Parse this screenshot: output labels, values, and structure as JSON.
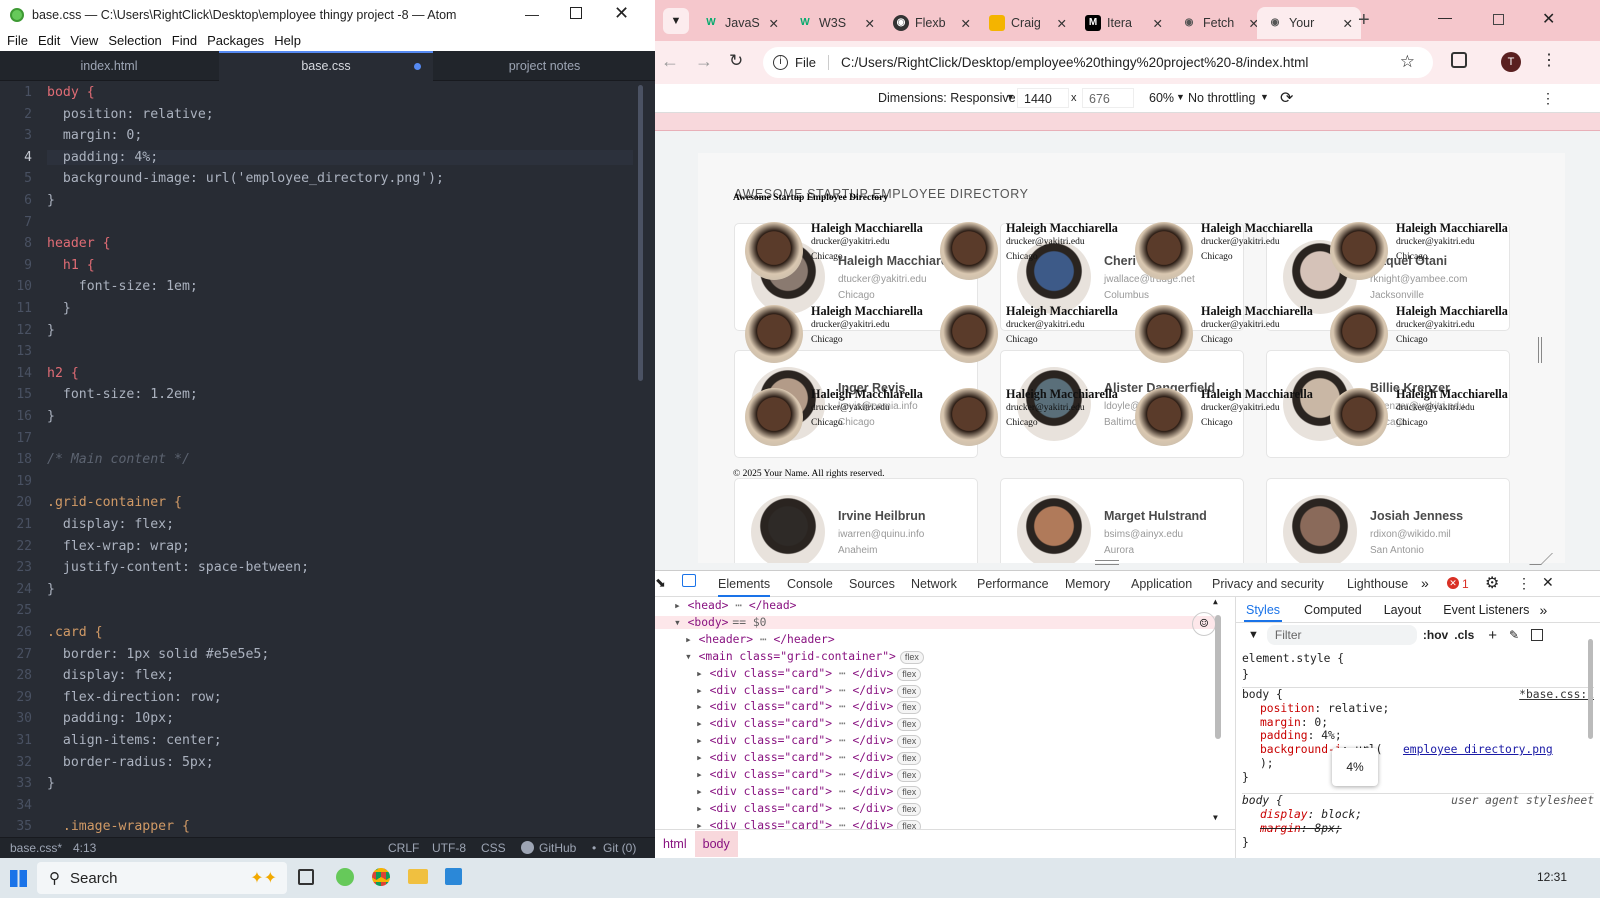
{
  "atom": {
    "title": "base.css — C:\\Users\\RightClick\\Desktop\\employee thingy project -8 — Atom",
    "menu": [
      "File",
      "Edit",
      "View",
      "Selection",
      "Find",
      "Packages",
      "Help"
    ],
    "tabs": [
      {
        "label": "index.html",
        "active": false
      },
      {
        "label": "base.css",
        "active": true,
        "modified": true
      },
      {
        "label": "project notes",
        "active": false
      }
    ],
    "status": {
      "file": "base.css*",
      "cursor": "4:13",
      "line_ending": "CRLF",
      "encoding": "UTF-8",
      "grammar": "CSS",
      "github": "GitHub",
      "git": "Git (0)"
    }
  },
  "code_lines": [
    "body {",
    "  position: relative;",
    "  margin: 0;",
    "  padding: 4%;",
    "  background-image: url('employee_directory.png');",
    "}",
    "",
    "header {",
    "  h1 {",
    "    font-size: 1em;",
    "  }",
    "}",
    "",
    "h2 {",
    "  font-size: 1.2em;",
    "}",
    "",
    "/* Main content */",
    "",
    ".grid-container {",
    "  display: flex;",
    "  flex-wrap: wrap;",
    "  justify-content: space-between;",
    "}",
    "",
    ".card {",
    "  border: 1px solid #e5e5e5;",
    "  display: flex;",
    "  flex-direction: row;",
    "  padding: 10px;",
    "  align-items: center;",
    "  border-radius: 5px;",
    "}",
    "",
    "  .image-wrapper {"
  ],
  "chrome": {
    "tabs": [
      "JavaS",
      "W3S",
      "Flexb",
      "Craig",
      "Itera",
      "Fetch",
      "Your"
    ],
    "url_label": "File",
    "url": "C:/Users/RightClick/Desktop/employee%20thingy%20project%20-8/index.html",
    "profile": "T",
    "device_toolbar": {
      "dimensions": "Dimensions: Responsive",
      "width": "1440",
      "x": "x",
      "height": "676",
      "zoom": "60%",
      "throttling": "No throttling"
    }
  },
  "page": {
    "bg_heading": "AWESOME STARTUP EMPLOYEE DIRECTORY",
    "overlay_heading": "Awesome Startup Employee Directory",
    "footer": "© 2025 Your Name. All rights reserved.",
    "bg_cards": [
      {
        "name": "Haleigh Macchiarella",
        "email": "dtucker@yakitri.edu",
        "city": "Chicago"
      },
      {
        "name": "Cheri Wallace",
        "email": "jwallace@trudge.net",
        "city": "Columbus"
      },
      {
        "name": "Raquel Otani",
        "email": "rknight@yambee.com",
        "city": "Jacksonville"
      },
      {
        "name": "Inger Revis",
        "email": "lrevis@eamia.info",
        "city": "Chicago"
      },
      {
        "name": "Alister Dangerfield",
        "email": "ldoyle@lyxyn.com",
        "city": "Baltimore"
      },
      {
        "name": "Billie Krenzer",
        "email": "bkrenzer@yakitri.edu",
        "city": "Chicago"
      },
      {
        "name": "Irvine Heilbrun",
        "email": "iwarren@quinu.info",
        "city": "Anaheim"
      },
      {
        "name": "Marget Hulstrand",
        "email": "bsims@ainyx.edu",
        "city": "Aurora"
      },
      {
        "name": "Josiah Jenness",
        "email": "rdixon@wikido.mil",
        "city": "San Antonio"
      }
    ],
    "overlay_card": {
      "name": "Haleigh Macchiarella",
      "email": "drucker@yakitri.edu",
      "city": "Chicago"
    }
  },
  "devtools": {
    "tabs": [
      "Elements",
      "Console",
      "Sources",
      "Network",
      "Performance",
      "Memory",
      "Application",
      "Privacy and security",
      "Lighthouse"
    ],
    "error_count": "1",
    "dom": [
      {
        "indent": 1,
        "open": "<head>",
        "close": "</head>",
        "collapsed": true
      },
      {
        "indent": 1,
        "open": "<body>",
        "eq": "== $0",
        "expanded": true
      },
      {
        "indent": 2,
        "open": "<header>",
        "close": "</header>",
        "collapsed": true
      },
      {
        "indent": 2,
        "open": "<main class=\"grid-container\">",
        "badge": "flex",
        "expanded": true
      },
      {
        "indent": 3,
        "open": "<div class=\"card\">",
        "close": "</div>",
        "badge": "flex",
        "collapsed": true
      },
      {
        "indent": 3,
        "open": "<div class=\"card\">",
        "close": "</div>",
        "badge": "flex",
        "collapsed": true
      },
      {
        "indent": 3,
        "open": "<div class=\"card\">",
        "close": "</div>",
        "badge": "flex",
        "collapsed": true
      },
      {
        "indent": 3,
        "open": "<div class=\"card\">",
        "close": "</div>",
        "badge": "flex",
        "collapsed": true
      },
      {
        "indent": 3,
        "open": "<div class=\"card\">",
        "close": "</div>",
        "badge": "flex",
        "collapsed": true
      },
      {
        "indent": 3,
        "open": "<div class=\"card\">",
        "close": "</div>",
        "badge": "flex",
        "collapsed": true
      },
      {
        "indent": 3,
        "open": "<div class=\"card\">",
        "close": "</div>",
        "badge": "flex",
        "collapsed": true
      },
      {
        "indent": 3,
        "open": "<div class=\"card\">",
        "close": "</div>",
        "badge": "flex",
        "collapsed": true
      },
      {
        "indent": 3,
        "open": "<div class=\"card\">",
        "close": "</div>",
        "badge": "flex",
        "collapsed": true
      },
      {
        "indent": 3,
        "open": "<div class=\"card\">",
        "close": "</div>",
        "badge": "flex",
        "collapsed": true
      }
    ],
    "styles_tabs": [
      "Styles",
      "Computed",
      "Layout",
      "Event Listeners"
    ],
    "filter_placeholder": "Filter",
    "hov": ":hov",
    "cls": ".cls",
    "rules": {
      "element_style": "element.style {",
      "body_selector": "body {",
      "body_source": "*base.css:1",
      "body_props": [
        {
          "name": "position",
          "value": "relative;"
        },
        {
          "name": "margin",
          "value": "0;"
        },
        {
          "name": "padding",
          "value": "4%;"
        },
        {
          "name": "background-i",
          "value": "url("
        },
        {
          "name": "",
          "value": ");"
        }
      ],
      "bg_link": "employee directory.png",
      "tooltip": "4%",
      "ua_selector": "body {",
      "ua_source": "user agent stylesheet",
      "ua_props": [
        {
          "name": "display",
          "value": "block;"
        },
        {
          "name": "margin",
          "value": "8px;"
        }
      ]
    },
    "breadcrumbs": [
      "html",
      "body"
    ]
  },
  "taskbar": {
    "search": "Search",
    "time": "12:31"
  }
}
